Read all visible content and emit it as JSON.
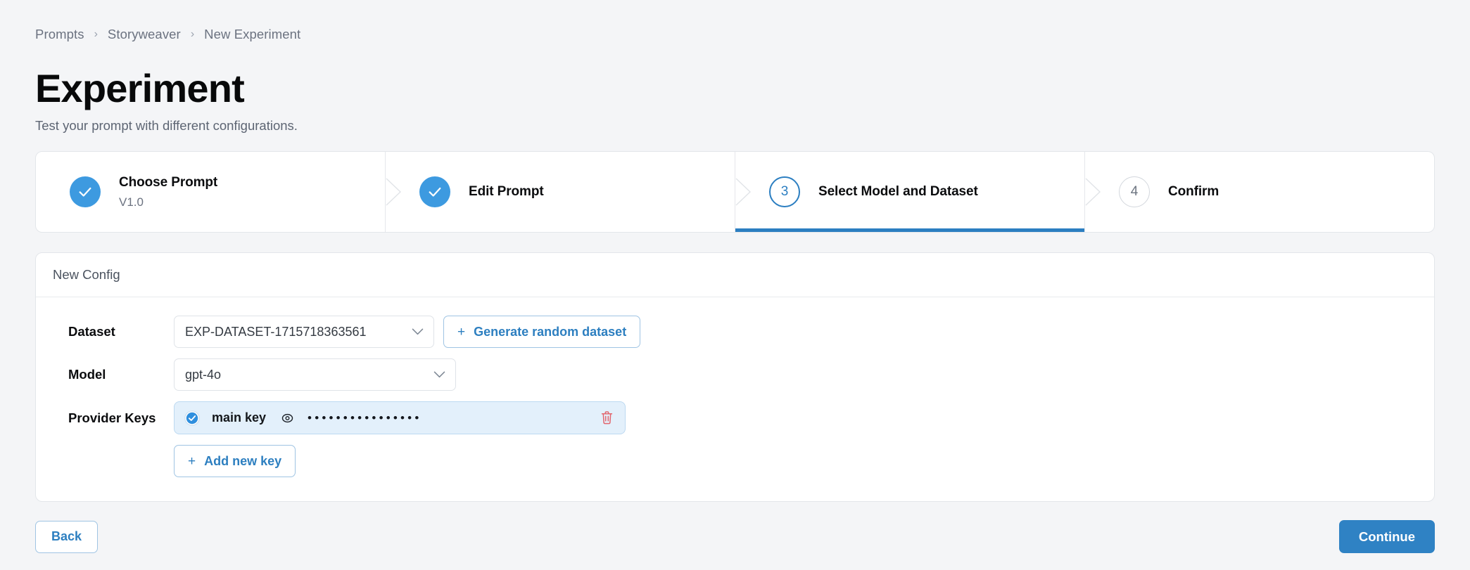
{
  "breadcrumb": {
    "items": [
      {
        "label": "Prompts"
      },
      {
        "label": "Storyweaver"
      },
      {
        "label": "New Experiment"
      }
    ],
    "separator": "›"
  },
  "header": {
    "title": "Experiment",
    "subtitle": "Test your prompt with different configurations."
  },
  "stepper": {
    "steps": [
      {
        "number": "1",
        "label": "Choose Prompt",
        "sub": "V1.0",
        "state": "done",
        "icon": "check-icon"
      },
      {
        "number": "2",
        "label": "Edit Prompt",
        "sub": "",
        "state": "done",
        "icon": "check-icon"
      },
      {
        "number": "3",
        "label": "Select Model and Dataset",
        "sub": "",
        "state": "active",
        "icon": ""
      },
      {
        "number": "4",
        "label": "Confirm",
        "sub": "",
        "state": "todo",
        "icon": ""
      }
    ]
  },
  "config": {
    "card_title": "New Config",
    "dataset": {
      "label": "Dataset",
      "value": "EXP-DATASET-1715718363561",
      "generate_button": "Generate random dataset",
      "plus": "+"
    },
    "model": {
      "label": "Model",
      "value": "gpt-4o"
    },
    "provider_keys": {
      "label": "Provider Keys",
      "keys": [
        {
          "name": "main key",
          "masked_value": "••••••••••••••••",
          "selected": true
        }
      ],
      "add_button": "Add new key",
      "plus": "+"
    }
  },
  "footer": {
    "back_label": "Back",
    "continue_label": "Continue"
  },
  "colors": {
    "accent_blue": "#2f82c4",
    "step_done": "#3d9ae0",
    "key_row_bg": "#e3f0fb",
    "danger_red": "#e2666e",
    "page_bg": "#f4f5f7"
  }
}
